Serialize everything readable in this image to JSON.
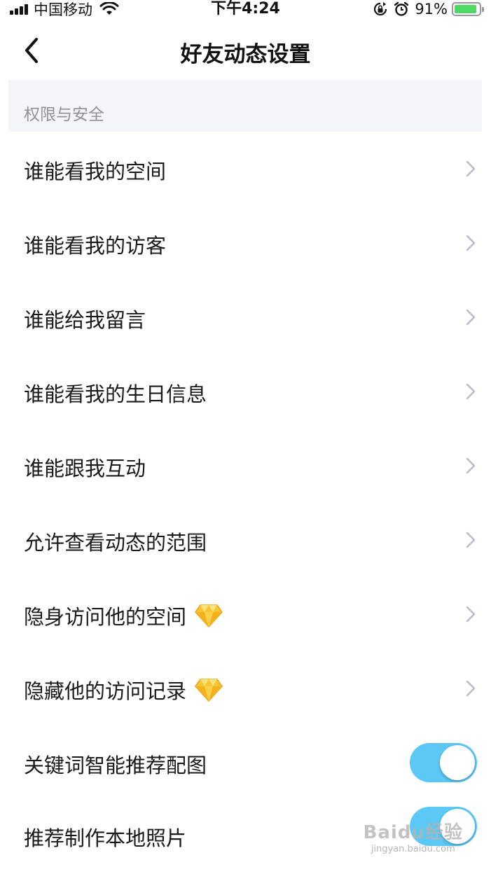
{
  "status_bar": {
    "carrier": "中国移动",
    "time": "下午4:24",
    "battery_percent": "91%",
    "battery_level": 0.91,
    "icons": [
      "signal-icon",
      "wifi-icon",
      "rotation-lock-icon",
      "alarm-icon",
      "battery-icon"
    ]
  },
  "nav": {
    "title": "好友动态设置",
    "back_icon": "chevron-left-icon"
  },
  "section": {
    "title": "权限与安全"
  },
  "rows": [
    {
      "label": "谁能看我的空间",
      "type": "link"
    },
    {
      "label": "谁能看我的访客",
      "type": "link"
    },
    {
      "label": "谁能给我留言",
      "type": "link"
    },
    {
      "label": "谁能看我的生日信息",
      "type": "link"
    },
    {
      "label": "谁能跟我互动",
      "type": "link"
    },
    {
      "label": "允许查看动态的范围",
      "type": "link"
    },
    {
      "label": "隐身访问他的空间",
      "type": "link",
      "badge": "diamond-vip-icon"
    },
    {
      "label": "隐藏他的访问记录",
      "type": "link",
      "badge": "diamond-vip-icon"
    },
    {
      "label": "关键词智能推荐配图",
      "type": "toggle",
      "on": true
    },
    {
      "label": "推荐制作本地照片",
      "type": "toggle",
      "on": true
    }
  ],
  "watermark": {
    "logo": "Baidu经验",
    "url": "jingyan.baidu.com"
  },
  "colors": {
    "toggle_on": "#5bc8f5",
    "section_bg": "#f3f5f9",
    "section_text": "#8e929a",
    "chevron": "#b8bcc4",
    "battery": "#4cd964"
  }
}
